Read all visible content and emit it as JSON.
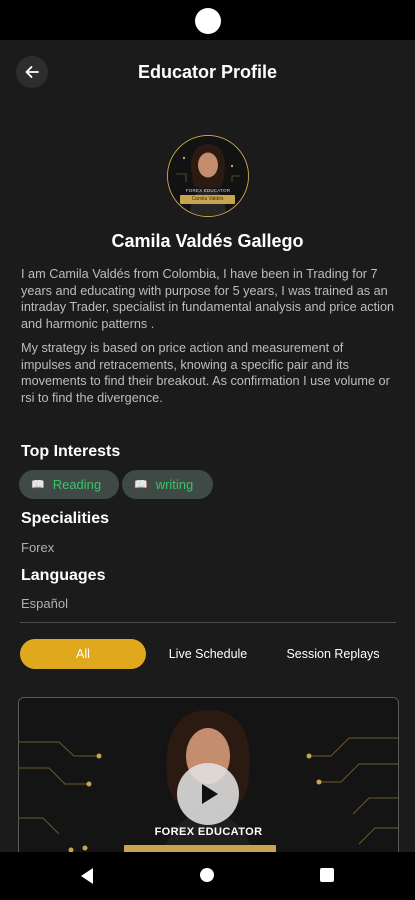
{
  "header": {
    "title": "Educator Profile",
    "back_icon": "arrow-left-icon"
  },
  "profile": {
    "avatar_caption": "FOREX EDUCATOR",
    "avatar_name": "Camila Valdés",
    "name": "Camila Valdés Gallego",
    "bio": [
      "I am Camila Valdés from Colombia, I have been in Trading for 7 years and educating with purpose for 5 years, I was trained as an intraday Trader, specialist in fundamental analysis and price action and harmonic patterns .",
      "My strategy is based on price action and measurement of impulses and retracements, knowing a specific pair and its movements to find their breakout. As confirmation I use volume or rsi to find the divergence."
    ]
  },
  "interests": {
    "title": "Top Interests",
    "items": [
      "Reading",
      "writing"
    ],
    "icon": "book-icon"
  },
  "specialities": {
    "title": "Specialities",
    "value": "Forex"
  },
  "languages": {
    "title": "Languages",
    "value": "Español"
  },
  "tabs": [
    {
      "label": "All",
      "active": true
    },
    {
      "label": "Live Schedule",
      "active": false
    },
    {
      "label": "Session Replays",
      "active": false
    }
  ],
  "video": {
    "caption": "FOREX EDUCATOR",
    "play_icon": "play-icon"
  },
  "colors": {
    "accent": "#e0a91d",
    "gold": "#c9a44e",
    "chip_bg": "#3f4a47",
    "chip_text": "#3fc06a",
    "background": "#1b1b1b"
  }
}
